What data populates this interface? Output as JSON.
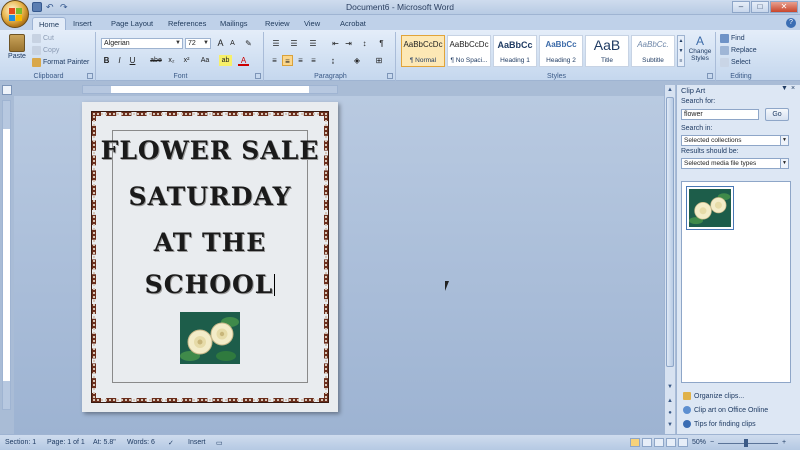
{
  "window": {
    "title": "Document6 - Microsoft Word",
    "minimize": "–",
    "maximize": "□",
    "close": "✕",
    "qat_undo": "↶",
    "qat_redo": "↷"
  },
  "tabs": [
    "Home",
    "Insert",
    "Page Layout",
    "References",
    "Mailings",
    "Review",
    "View",
    "Acrobat"
  ],
  "help": "?",
  "ribbon": {
    "clipboard": {
      "paste": "Paste",
      "cut": "Cut",
      "copy": "Copy",
      "format_painter": "Format Painter",
      "label": "Clipboard"
    },
    "font": {
      "family": "Algerian",
      "size": "72",
      "grow": "A",
      "shrink": "A",
      "label": "Font",
      "bold": "B",
      "italic": "I",
      "underline": "U",
      "strike": "abe",
      "subscript": "x₂",
      "superscript": "x²",
      "change_case": "Aa",
      "highlight": "ab",
      "font_color": "A"
    },
    "paragraph": {
      "label": "Paragraph",
      "show_marks": "¶"
    },
    "styles": {
      "label": "Styles",
      "items": [
        {
          "sample": "AaBbCcDc",
          "name": "¶ Normal"
        },
        {
          "sample": "AaBbCcDc",
          "name": "¶ No Spaci..."
        },
        {
          "sample": "AaBbCc",
          "name": "Heading 1"
        },
        {
          "sample": "AaBbCc",
          "name": "Heading 2"
        },
        {
          "sample": "AaB",
          "name": "Title"
        },
        {
          "sample": "AaBbCc.",
          "name": "Subtitle"
        }
      ],
      "change_styles": "Change Styles"
    },
    "editing": {
      "label": "Editing",
      "find": "Find",
      "replace": "Replace",
      "select": "Select"
    }
  },
  "document": {
    "lines": [
      "FLOWER SALE",
      "SATURDAY",
      "AT THE",
      "SCHOOL"
    ]
  },
  "clipart_pane": {
    "title": "Clip Art",
    "close": "×",
    "search_label": "Search for:",
    "search_value": "flower",
    "go": "Go",
    "search_in_label": "Search in:",
    "search_in_value": "Selected collections",
    "results_label": "Results should be:",
    "results_value": "Selected media file types",
    "links": [
      "Organize clips...",
      "Clip art on Office Online",
      "Tips for finding clips"
    ]
  },
  "status": {
    "section": "Section: 1",
    "page": "Page: 1 of 1",
    "at": "At: 5.8\"",
    "words": "Words: 6",
    "mode": "Insert",
    "zoom": "50%"
  },
  "colors": {
    "page_border": "#6b2e1c",
    "clipart_bg": "#1d5d4a",
    "rose": "#f3ecc8"
  }
}
